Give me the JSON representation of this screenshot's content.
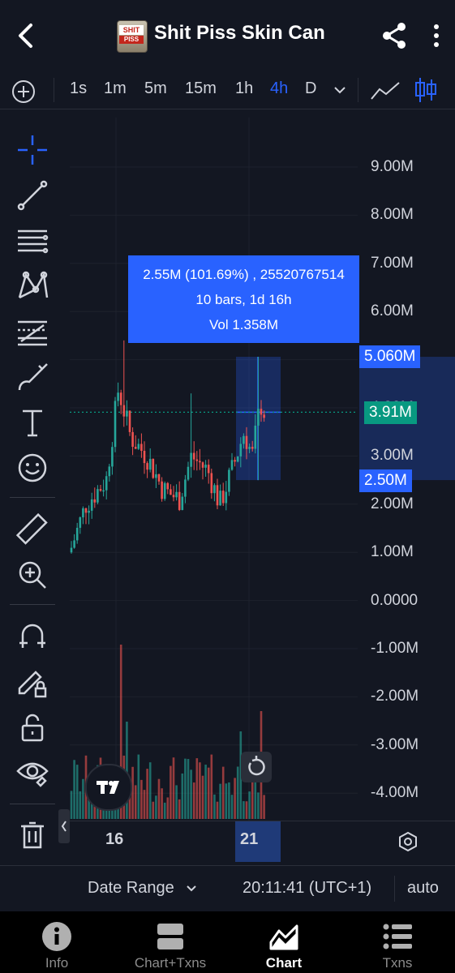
{
  "header": {
    "title": "Shit Piss Skin Can",
    "logo_top": "SHIT",
    "logo_bottom": "PISS"
  },
  "timeframes": [
    {
      "label": "1s",
      "active": false
    },
    {
      "label": "1m",
      "active": false
    },
    {
      "label": "5m",
      "active": false
    },
    {
      "label": "15m",
      "active": false
    },
    {
      "label": "1h",
      "active": false
    },
    {
      "label": "4h",
      "active": true
    },
    {
      "label": "D",
      "active": false
    }
  ],
  "left_tools": [
    "crosshair-icon",
    "trend-line-icon",
    "horizontal-lines-icon",
    "pattern-icon",
    "fib-levels-icon",
    "brush-icon",
    "text-icon",
    "emoji-icon",
    "ruler-icon",
    "zoom-in-icon",
    "magnet-icon",
    "lock-drawing-icon",
    "unlock-icon",
    "eye-icon",
    "trash-icon",
    "layers-icon"
  ],
  "colors": {
    "bg": "#131722",
    "up": "#26a69a",
    "down": "#ef5350",
    "accent": "#2962ff",
    "grid": "#1e222d",
    "current_price": "#089981"
  },
  "tooltip": {
    "line1": "2.55M (101.69%) , 25520767514",
    "line2": "10 bars, 1d 16h",
    "line3": "Vol 1.358M"
  },
  "price_badges": {
    "upper": "5.060M",
    "current": "3.91M",
    "lower": "2.50M"
  },
  "chart_data": {
    "type": "candlestick",
    "y_axis_labels": [
      "9.00M",
      "8.00M",
      "7.00M",
      "6.00M",
      "5.00M",
      "4.00M",
      "3.00M",
      "2.00M",
      "1.00M",
      "0.0000",
      "-1.00M",
      "-2.00M",
      "-3.00M",
      "-4.00M"
    ],
    "y_axis_values": [
      9,
      8,
      7,
      6,
      5,
      4,
      3,
      2,
      1,
      0,
      -1,
      -2,
      -3,
      -4
    ],
    "x_axis_labels": [
      "16",
      "21"
    ],
    "ylim": [
      -4.5,
      10
    ],
    "unit": "M",
    "current_price": 3.91,
    "measure_range": {
      "from": 2.5,
      "to": 5.06
    }
  },
  "status": {
    "date_range": "Date Range",
    "time": "20:11:41 (UTC+1)",
    "scale": "auto"
  },
  "nav": [
    {
      "label": "Info",
      "active": false
    },
    {
      "label": "Chart+Txns",
      "active": false
    },
    {
      "label": "Chart",
      "active": true
    },
    {
      "label": "Txns",
      "active": false
    }
  ]
}
